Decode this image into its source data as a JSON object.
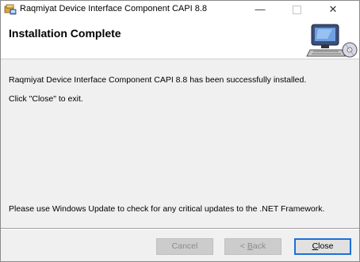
{
  "window": {
    "title": "Raqmiyat Device Interface Component CAPI 8.8",
    "controls": {
      "minimize": "—",
      "close": "✕"
    }
  },
  "banner": {
    "title": "Installation Complete"
  },
  "messages": {
    "success": "Raqmiyat Device Interface Component CAPI 8.8 has been successfully installed.",
    "exit_hint": "Click \"Close\" to exit.",
    "update_hint": "Please use Windows Update to check for any critical updates to the .NET Framework."
  },
  "buttons": {
    "cancel": "Cancel",
    "back_prefix": "< ",
    "back_accel": "B",
    "back_rest": "ack",
    "close_accel": "C",
    "close_rest": "lose"
  },
  "icons": {
    "app": "installer-app-icon",
    "banner": "computer-setup-icon"
  },
  "colors": {
    "focus_border": "#1e6fd8",
    "window_bg": "#f0f0f0"
  }
}
